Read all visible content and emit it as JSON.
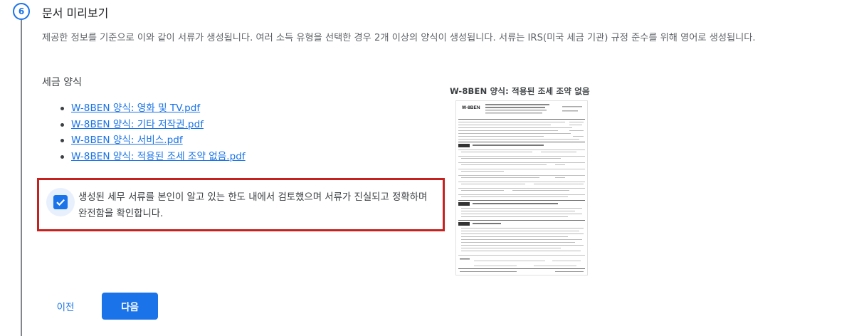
{
  "step": {
    "number": "6",
    "title": "문서 미리보기",
    "description": "제공한 정보를 기준으로 이와 같이 서류가 생성됩니다. 여러 소득 유형을 선택한 경우 2개 이상의 양식이 생성됩니다. 서류는 IRS(미국 세금 기관) 규정 준수를 위해 영어로 생성됩니다."
  },
  "tax_forms": {
    "heading": "세금 양식",
    "files": [
      "W-8BEN 양식: 영화 및 TV.pdf",
      "W-8BEN 양식: 기타 저작권.pdf",
      "W-8BEN 양식: 서비스.pdf",
      "W-8BEN 양식: 적용된 조세 조약 없음.pdf"
    ]
  },
  "confirmation": {
    "checked": true,
    "text": "생성된 세무 서류를 본인이 알고 있는 한도 내에서 검토했으며 서류가 진실되고 정확하며 완전함을 확인합니다."
  },
  "preview": {
    "title": "W-8BEN 양식: 적용된 조세 조약 없음",
    "form_name": "W-8BEN"
  },
  "icons": {
    "checkbox": "check-icon"
  },
  "colors": {
    "accent": "#1a73e8",
    "highlight_border": "#c5221f"
  },
  "nav": {
    "prev_label": "이전",
    "next_label": "다음"
  }
}
